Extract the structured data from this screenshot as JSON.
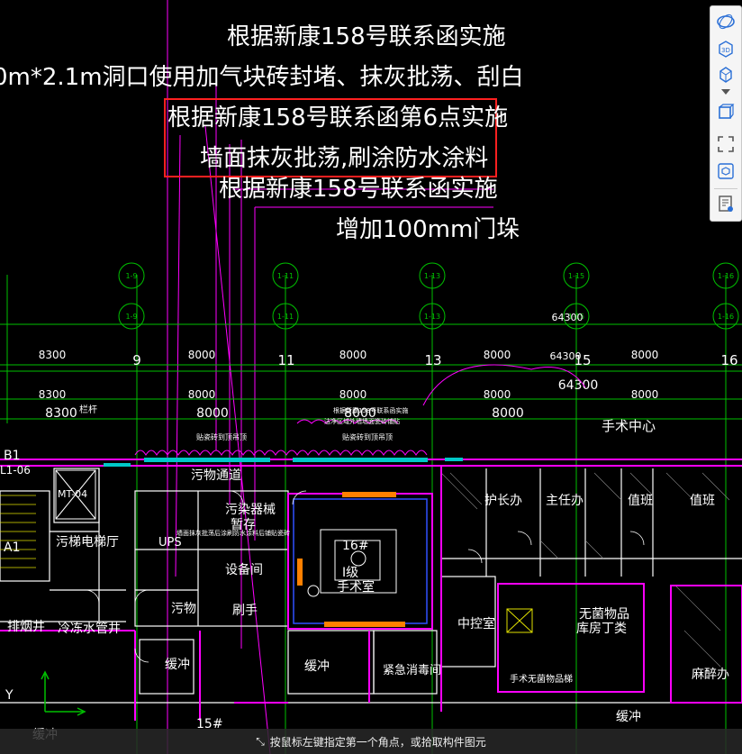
{
  "annotations": {
    "line1": "根据新康158号联系函实施",
    "line2": "0m*2.1m洞口使用加气块砖封堵、抹灰批荡、刮白",
    "line3": "根据新康158号联系函第6点实施",
    "line4": "墙面抹灰批荡,刷涂防水涂料",
    "line5": "根据新康158号联系函实施",
    "line6": "增加100mm门垛"
  },
  "grid": {
    "bubbles_top": [
      "1-9",
      "1-11",
      "1-13",
      "1-15",
      "1-16"
    ],
    "bubbles_mid": [
      "1-9",
      "1-11",
      "1-13",
      "1-15",
      "1-16"
    ],
    "axis_numbers": [
      "9",
      "11",
      "13",
      "15",
      "16"
    ],
    "dims_row1": [
      "8300",
      "8000",
      "8000",
      "8000",
      "8000"
    ],
    "dims_row2": [
      "8300",
      "8000",
      "8000",
      "8000",
      "8000"
    ],
    "dims_row3": [
      "8300",
      "8000",
      "8000",
      "8000"
    ],
    "total_top": "64300",
    "total_a": "64300",
    "total_b": "64300"
  },
  "rooms": {
    "dirty_passage": "污物通道",
    "dirty_instruments": "污染器械",
    "temp_storage": "暂存",
    "ups": "UPS",
    "equipment": "设备间",
    "dirty_elevator_hall": "污梯电梯厅",
    "dirty": "污物",
    "hand_wash": "刷手",
    "or_16": "16#",
    "or_class": "I级",
    "or_name": "手术室",
    "buffer1": "缓冲",
    "buffer2": "缓冲",
    "emergency_disinfect": "紧急消毒间",
    "head_nurse": "护长办",
    "director": "主任办",
    "duty1": "值班",
    "duty2": "值班",
    "central_control": "中控室",
    "sterile_goods": "无菌物品",
    "warehouse": "库房丁类",
    "sterile_elevator": "手术无菌物品梯",
    "anesthesia": "麻醉办",
    "surgery_center": "手术中心",
    "smoke_shaft": "排烟井",
    "chilled_pipe": "冷冻水管井",
    "buffer3": "缓冲",
    "or_15": "15#",
    "buffer4": "缓冲",
    "mt04": "MT-04",
    "b1": "B1",
    "l106": "L1-06",
    "a1": "A1",
    "y_axis": "Y",
    "railing": "栏杆",
    "note_tile1": "贴瓷砖到顶吊顶",
    "note_tile2": "贴瓷砖到顶吊顶",
    "note_wall": "墙面抹灰批荡后涂刷防水涂料后铺贴瓷砖",
    "note_top1": "根据新康158号联系函实施",
    "note_top2": "洁净区域外墙墙面瓷砖铺贴"
  },
  "toolbar": {
    "items": [
      "orbit-icon",
      "3d-view-icon",
      "cube-icon",
      "view-dropdown-icon",
      "box-icon",
      "fullscreen-icon",
      "isolate-icon",
      "properties-icon"
    ]
  },
  "status": {
    "prompt": "按鼠标左键指定第一个角点，或拾取构件图元"
  },
  "colors": {
    "grid_green": "#00c000",
    "wall_magenta": "#ff00ff",
    "wall_white": "#ffffff",
    "highlight_red": "#ff2020",
    "blue_line": "#3050ff",
    "cyan": "#00c8c8",
    "orange": "#ff8000",
    "yellow": "#e0e000"
  }
}
